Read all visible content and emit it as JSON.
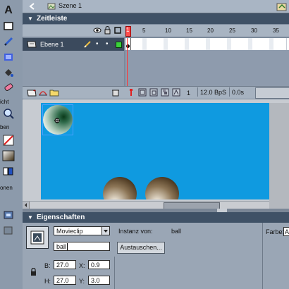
{
  "scene": {
    "label": "Szene 1"
  },
  "timeline": {
    "title": "Zeitleiste",
    "frame_numbers": [
      "1",
      "5",
      "10",
      "15",
      "20",
      "25",
      "30",
      "35"
    ],
    "layer_name": "Ebene 1",
    "current_frame": "1",
    "frame_rate": "12.0 BpS",
    "time": "0.0s"
  },
  "tools": {
    "label_view": "icht",
    "label_colors": "ben",
    "label_options": "onen"
  },
  "properties": {
    "title": "Eigenschaften",
    "symbol_type": "Movieclip",
    "instance_name": "ball",
    "instance_of_label": "Instanz von:",
    "instance_of_value": "ball",
    "swap_button": "Austauschen...",
    "color_label": "Farbe:",
    "color_value": "A",
    "w_label": "B:",
    "w_value": "27.0",
    "h_label": "H:",
    "h_value": "27.0",
    "x_label": "X:",
    "x_value": "0.9",
    "y_label": "Y:",
    "y_value": "3.0"
  },
  "colors": {
    "stage": "#0f9ae0",
    "panel_header": "#3f5166",
    "playhead": "#ff3333",
    "layer_selected": "#3b4a5d"
  }
}
